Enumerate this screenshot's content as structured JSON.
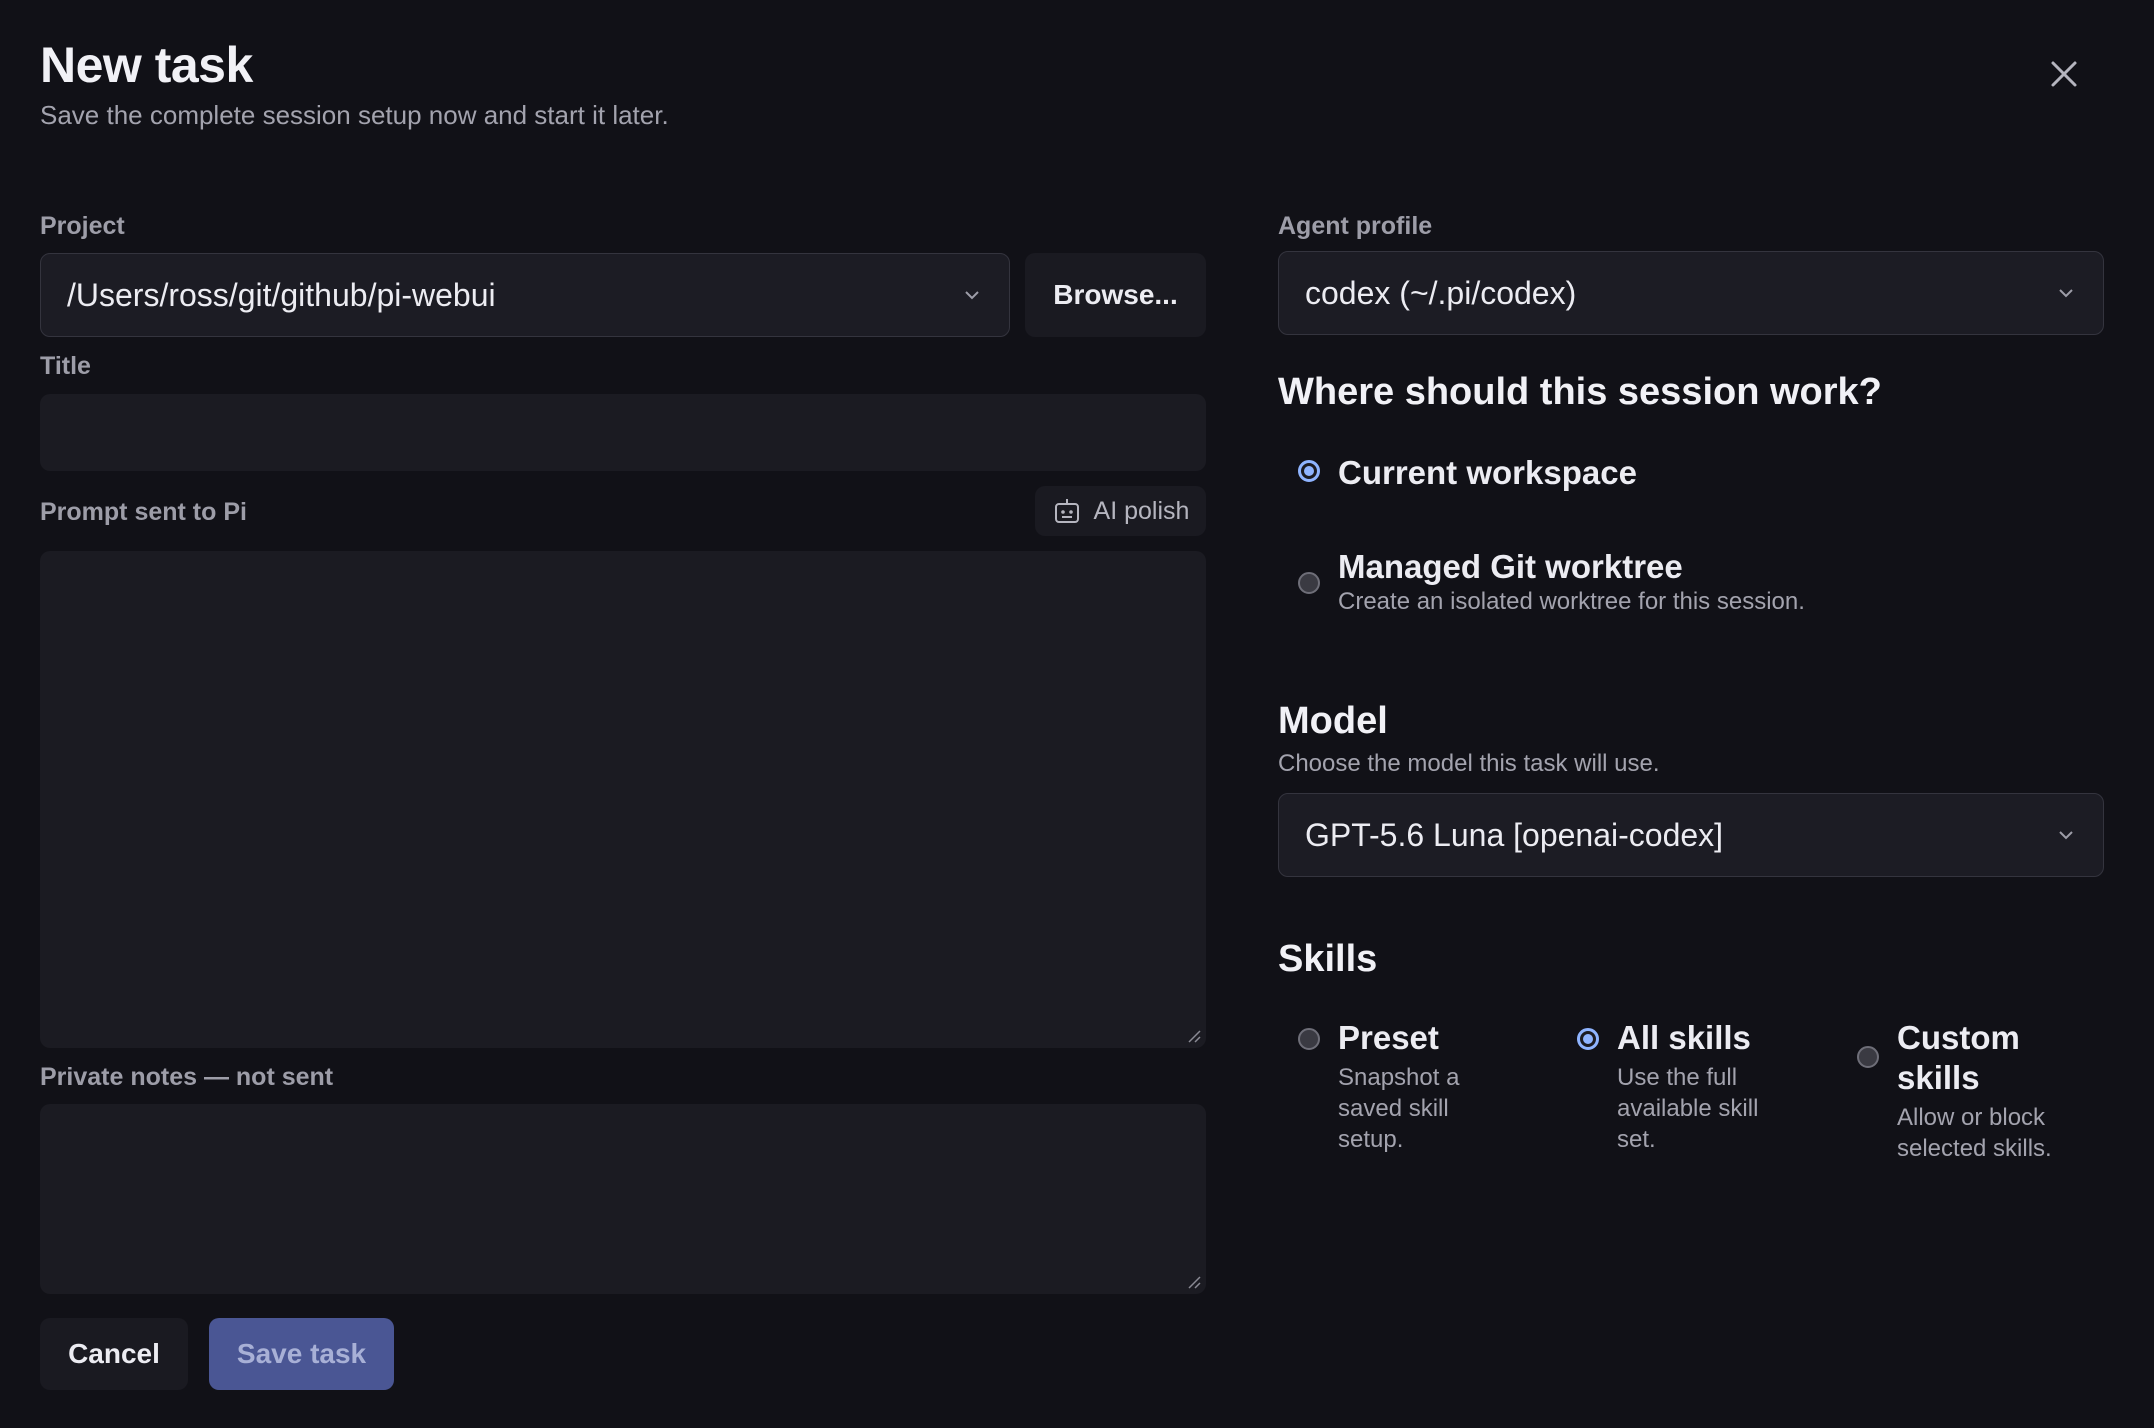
{
  "dialog": {
    "title": "New task",
    "subtitle": "Save the complete session setup now and start it later."
  },
  "project": {
    "label": "Project",
    "value": "/Users/ross/git/github/pi-webui",
    "browse_label": "Browse..."
  },
  "title_field": {
    "label": "Title",
    "value": ""
  },
  "prompt": {
    "label": "Prompt sent to Pi",
    "ai_polish_label": "AI polish",
    "value": ""
  },
  "notes": {
    "label": "Private notes — not sent",
    "value": ""
  },
  "actions": {
    "cancel_label": "Cancel",
    "save_label": "Save task"
  },
  "agent_profile": {
    "label": "Agent profile",
    "value": "codex (~/.pi/codex)"
  },
  "workspace": {
    "heading": "Where should this session work?",
    "options": [
      {
        "title": "Current workspace",
        "description": "",
        "selected": true
      },
      {
        "title": "Managed Git worktree",
        "description": "Create an isolated worktree for this session.",
        "selected": false
      }
    ]
  },
  "model": {
    "heading": "Model",
    "description": "Choose the model this task will use.",
    "value": "GPT-5.6 Luna [openai-codex]"
  },
  "skills": {
    "heading": "Skills",
    "options": [
      {
        "title": "Preset",
        "description_lines": [
          "Snapshot a",
          "saved skill",
          "setup."
        ],
        "selected": false
      },
      {
        "title": "All skills",
        "description_lines": [
          "Use the full",
          "available skill",
          "set."
        ],
        "selected": true
      },
      {
        "title_lines": [
          "Custom",
          "skills"
        ],
        "description_lines": [
          "Allow or block",
          "selected skills."
        ],
        "selected": false
      }
    ]
  },
  "colors": {
    "background": "#111117",
    "accent": "#8fb4ff",
    "save_button": "#4a5694"
  },
  "icons": {
    "close": "close-icon",
    "chevron": "chevron-down-icon",
    "ai_polish": "robot-icon"
  }
}
